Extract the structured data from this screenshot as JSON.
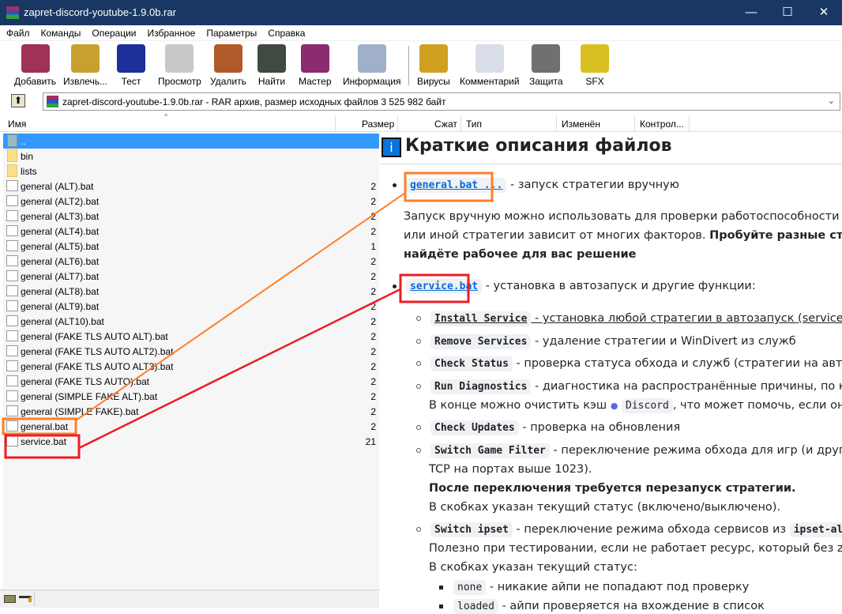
{
  "window": {
    "title": "zapret-discord-youtube-1.9.0b.rar",
    "minimize": "—",
    "maximize": "☐",
    "close": "✕"
  },
  "menu": [
    "Файл",
    "Команды",
    "Операции",
    "Избранное",
    "Параметры",
    "Справка"
  ],
  "toolbar": [
    {
      "label": "Добавить",
      "icon": "add-archive-icon",
      "color": "#a0325a"
    },
    {
      "label": "Извлечь...",
      "icon": "extract-icon",
      "color": "#c8a030"
    },
    {
      "label": "Тест",
      "icon": "test-icon",
      "color": "#1c2f9a"
    },
    {
      "label": "Просмотр",
      "icon": "view-book-icon",
      "color": "#c8c8c8"
    },
    {
      "label": "Удалить",
      "icon": "delete-bin-icon",
      "color": "#b05a2a"
    },
    {
      "label": "Найти",
      "icon": "binoculars-icon",
      "color": "#404a40"
    },
    {
      "label": "Мастер",
      "icon": "wizard-icon",
      "color": "#8a2a70"
    },
    {
      "label": "Информация",
      "icon": "info-icon",
      "color": "#9fb0c8"
    },
    {
      "label": "Вирусы",
      "icon": "virus-scan-icon",
      "color": "#d0a020"
    },
    {
      "label": "Комментарий",
      "icon": "comment-icon",
      "color": "#d8dde8"
    },
    {
      "label": "Защита",
      "icon": "shield-icon",
      "color": "#707070"
    },
    {
      "label": "SFX",
      "icon": "sfx-box-icon",
      "color": "#d8c020"
    }
  ],
  "address": "zapret-discord-youtube-1.9.0b.rar - RAR архив, размер исходных файлов 3 525 982 байт",
  "columns": {
    "name": "Имя",
    "size": "Размер",
    "packed": "Сжат",
    "type": "Тип",
    "modified": "Изменён",
    "crc": "Контрол..."
  },
  "files": [
    {
      "name": "..",
      "size": "",
      "kind": "up"
    },
    {
      "name": "bin",
      "size": "",
      "kind": "folder"
    },
    {
      "name": "lists",
      "size": "",
      "kind": "folder"
    },
    {
      "name": "general (ALT).bat",
      "size": "2",
      "kind": "file"
    },
    {
      "name": "general (ALT2).bat",
      "size": "2",
      "kind": "file"
    },
    {
      "name": "general (ALT3).bat",
      "size": "2",
      "kind": "file"
    },
    {
      "name": "general (ALT4).bat",
      "size": "2",
      "kind": "file"
    },
    {
      "name": "general (ALT5).bat",
      "size": "1",
      "kind": "file"
    },
    {
      "name": "general (ALT6).bat",
      "size": "2",
      "kind": "file"
    },
    {
      "name": "general (ALT7).bat",
      "size": "2",
      "kind": "file"
    },
    {
      "name": "general (ALT8).bat",
      "size": "2",
      "kind": "file"
    },
    {
      "name": "general (ALT9).bat",
      "size": "2",
      "kind": "file"
    },
    {
      "name": "general (ALT10).bat",
      "size": "2",
      "kind": "file"
    },
    {
      "name": "general (FAKE TLS AUTO ALT).bat",
      "size": "2",
      "kind": "file"
    },
    {
      "name": "general (FAKE TLS AUTO ALT2).bat",
      "size": "2",
      "kind": "file"
    },
    {
      "name": "general (FAKE TLS AUTO ALT3).bat",
      "size": "2",
      "kind": "file"
    },
    {
      "name": "general (FAKE TLS AUTO).bat",
      "size": "2",
      "kind": "file"
    },
    {
      "name": "general (SIMPLE FAKE ALT).bat",
      "size": "2",
      "kind": "file"
    },
    {
      "name": "general (SIMPLE FAKE).bat",
      "size": "2",
      "kind": "file"
    },
    {
      "name": "general.bat",
      "size": "2",
      "kind": "file"
    },
    {
      "name": "service.bat",
      "size": "21",
      "kind": "file"
    }
  ],
  "doc": {
    "title_icon": "i",
    "title": "Краткие описания файлов",
    "general_link": "general.bat ...",
    "general_desc": "- запуск стратегии вручную",
    "p1": "Запуск вручную можно использовать для проверки работоспособности стр",
    "p2a": "или иной стратегии зависит от многих факторов. ",
    "p2b": "Пробуйте разные стратег",
    "p3": "найдёте рабочее для вас решение",
    "service_link": "service.bat",
    "service_desc": "- установка в автозапуск и другие функции:",
    "items": [
      {
        "code": "Install Service",
        "desc": " - установка любой стратегии в автозапуск (services.ms"
      },
      {
        "code": "Remove Services",
        "desc": " - удаление стратегии и WinDivert из служб"
      },
      {
        "code": "Check Status",
        "desc": " - проверка статуса обхода и служб (стратегии на автозаг"
      },
      {
        "code": "Run Diagnostics",
        "desc": " - диагностика на распространённые причины, по кот"
      },
      {
        "code": "Check Updates",
        "desc": " - проверка на обновления"
      },
      {
        "code": "Switch Game Filter",
        "desc": " - переключение режима обхода для игр (и других"
      },
      {
        "code": "Switch ipset",
        "desc": " - переключение режима обхода сервисов из "
      }
    ],
    "diag_note_a": "В конце можно очистить кэш ",
    "diag_note_code": "Discord",
    "diag_note_b": ", что может помочь, если он н",
    "game_l2": "TCP на портах выше 1023).",
    "game_l3": "После переключения требуется перезапуск стратегии.",
    "game_l4": "В скобках указан текущий статус (включено/выключено).",
    "ipset_code": "ipset-all.",
    "ipset_l2": "Полезно при тестировании, если не работает ресурс, который без zapr",
    "ipset_l3": "В скобках указан текущий статус:",
    "none_code": "none",
    "none_desc": " - никакие айпи не попадают под проверку",
    "loaded_code": "loaded",
    "loaded_desc": " - айпи проверяется на вхождение в список"
  },
  "colors": {
    "titlebar": "#183863",
    "selection": "#3399ff",
    "orange": "#ff7f27",
    "red": "#ed1c24",
    "link": "#0969da"
  }
}
